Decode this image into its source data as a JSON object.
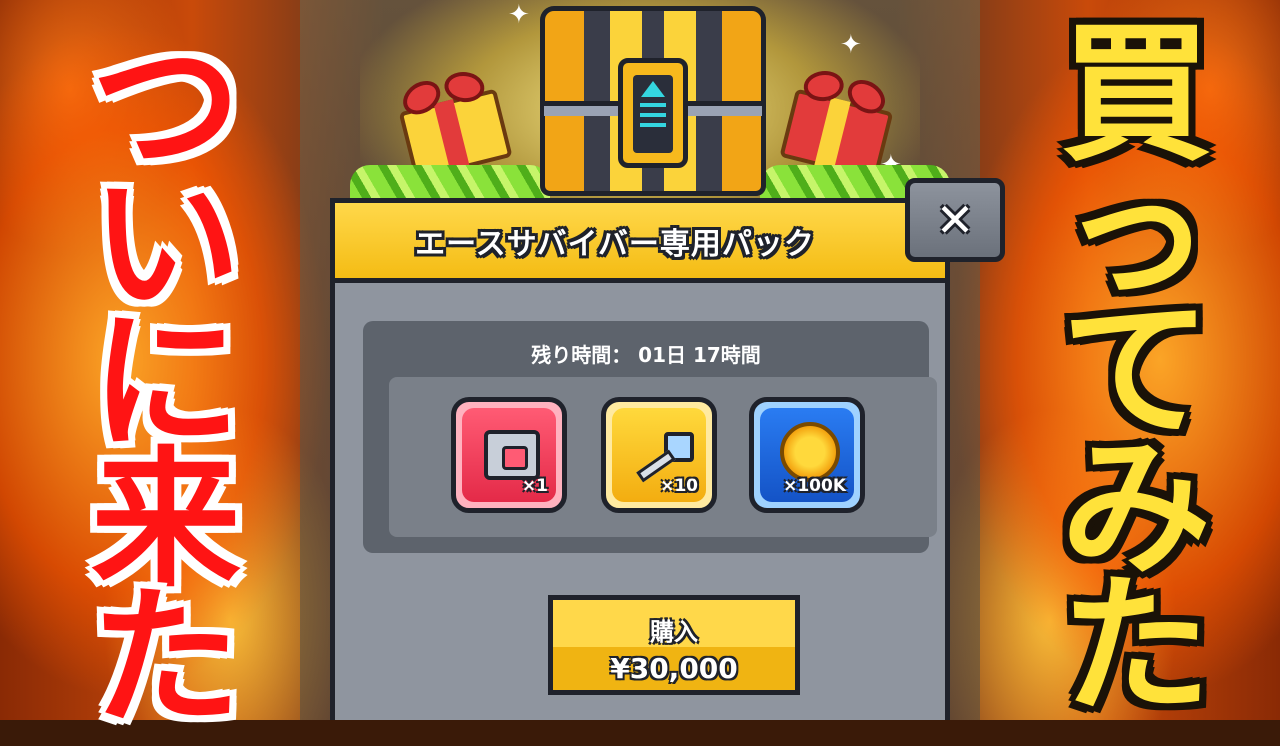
{
  "colors": {
    "dialog_header": "#f4bc14",
    "dialog_body": "#8f959f",
    "panel": "#5d636c",
    "outline": "#1f222b",
    "left_text": "#ff1414",
    "right_text": "#ffe23a"
  },
  "overlay": {
    "left_text": [
      "つ",
      "い",
      "に",
      "来",
      "た"
    ],
    "right_text": [
      "買",
      "っ",
      "て",
      "み",
      "た"
    ]
  },
  "dialog": {
    "title": "エースサバイバー専用パック",
    "close_glyph": "✕",
    "timer": "残り時間： 01日 17時間",
    "items": [
      {
        "icon": "chest-icon",
        "qty": "×1"
      },
      {
        "icon": "key-icon",
        "qty": "×10"
      },
      {
        "icon": "coin-icon",
        "qty": "×100K"
      }
    ],
    "buy_button": {
      "label": "購入",
      "price": "¥30,000"
    }
  }
}
